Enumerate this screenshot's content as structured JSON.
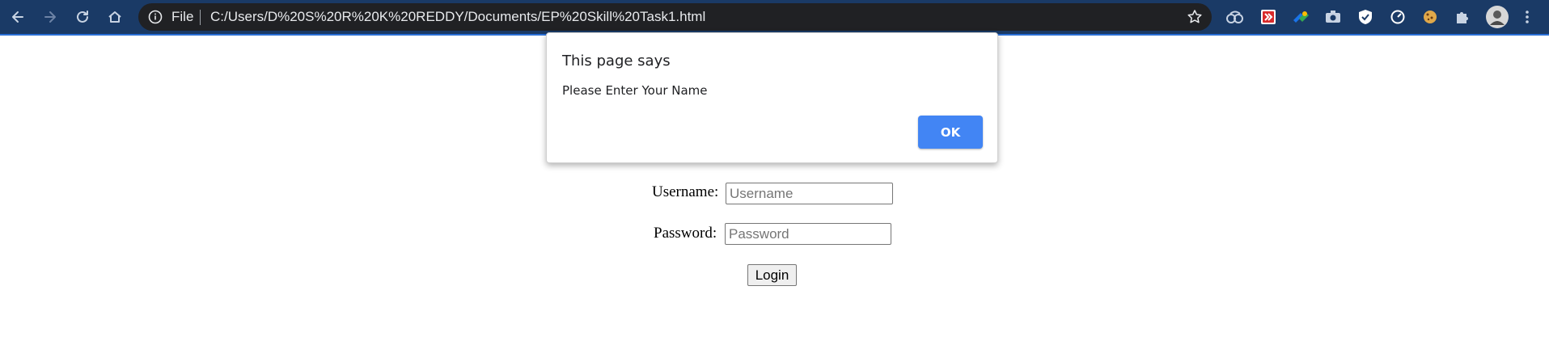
{
  "browser": {
    "address_bar": {
      "scheme_label": "File",
      "url": "C:/Users/D%20S%20R%20K%20REDDY/Documents/EP%20Skill%20Task1.html"
    },
    "nav_icons": [
      "back-arrow-icon",
      "forward-arrow-icon",
      "reload-icon",
      "home-icon"
    ],
    "extension_icons": [
      "cloud-extension-icon",
      "red-extension-icon",
      "green-extension-icon",
      "camera-extension-icon",
      "shield-extension-icon",
      "speedometer-extension-icon",
      "cookie-extension-icon",
      "puzzle-icon",
      "avatar",
      "menu-icon"
    ],
    "colors": {
      "toolbar": "#1a3a66",
      "omnibox": "#202124",
      "accent": "#4285f4"
    }
  },
  "dialog": {
    "title": "This page says",
    "message": "Please Enter Your Name",
    "ok_label": "OK"
  },
  "form": {
    "username_label": "Username:",
    "username_placeholder": "Username",
    "username_value": "",
    "password_label": "Password:",
    "password_placeholder": "Password",
    "password_value": "",
    "login_label": "Login"
  }
}
